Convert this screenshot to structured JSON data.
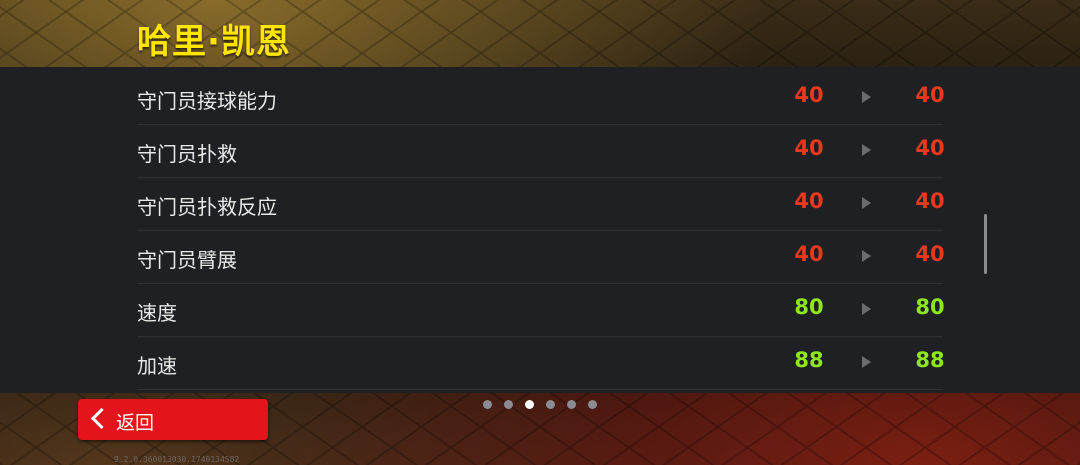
{
  "player": {
    "name": "哈里·凯恩"
  },
  "attributes": [
    {
      "label": "守门员接球能力",
      "current": "40",
      "next": "40",
      "color": "#e8381e"
    },
    {
      "label": "守门员扑救",
      "current": "40",
      "next": "40",
      "color": "#e8381e"
    },
    {
      "label": "守门员扑救反应",
      "current": "40",
      "next": "40",
      "color": "#e8381e"
    },
    {
      "label": "守门员臂展",
      "current": "40",
      "next": "40",
      "color": "#e8381e"
    },
    {
      "label": "速度",
      "current": "80",
      "next": "80",
      "color": "#8ee61c"
    },
    {
      "label": "加速",
      "current": "88",
      "next": "88",
      "color": "#8ee61c"
    }
  ],
  "pager": {
    "count": 6,
    "active_index": 2
  },
  "back_button": {
    "label": "返回",
    "icon": "chevron-left-icon"
  },
  "footer": {
    "version": "9.2.0.360013030.1740134582"
  },
  "colors": {
    "name": "#ffe600",
    "low": "#e8381e",
    "high": "#8ee61c",
    "back": "#e3141b"
  }
}
